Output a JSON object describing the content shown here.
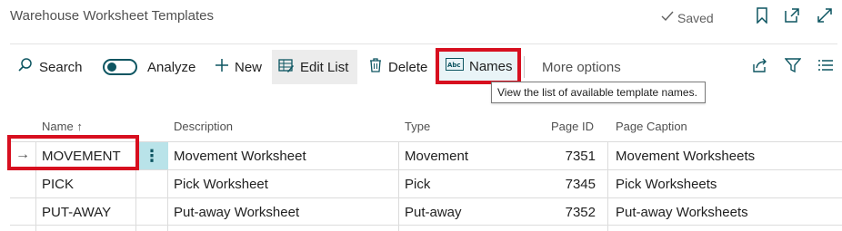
{
  "header": {
    "title": "Warehouse Worksheet Templates",
    "saved_label": "Saved",
    "icons": [
      "checkmark-icon",
      "bookmark-icon",
      "open-new-window-icon",
      "expand-icon"
    ]
  },
  "toolbar": {
    "search": "Search",
    "analyze": "Analyze",
    "new": "New",
    "edit_list": "Edit List",
    "delete": "Delete",
    "names": "Names",
    "more_options": "More options",
    "right_icons": [
      "share-icon",
      "filter-icon",
      "list-view-icon"
    ]
  },
  "tooltip": "View the list of available template names.",
  "table": {
    "columns": {
      "name": "Name",
      "description": "Description",
      "type": "Type",
      "page_id": "Page ID",
      "page_caption": "Page Caption"
    },
    "sort_indicator": "↑",
    "rows": [
      {
        "name": "MOVEMENT",
        "description": "Movement Worksheet",
        "type": "Movement",
        "page_id": "7351",
        "page_caption": "Movement Worksheets"
      },
      {
        "name": "PICK",
        "description": "Pick Worksheet",
        "type": "Pick",
        "page_id": "7345",
        "page_caption": "Pick Worksheets"
      },
      {
        "name": "PUT-AWAY",
        "description": "Put-away Worksheet",
        "type": "Put-away",
        "page_id": "7352",
        "page_caption": "Put-away Worksheets"
      }
    ]
  },
  "colors": {
    "accent": "#0d5561",
    "highlight_box": "#d70f1f",
    "selected_cell": "#b9e3e9"
  }
}
